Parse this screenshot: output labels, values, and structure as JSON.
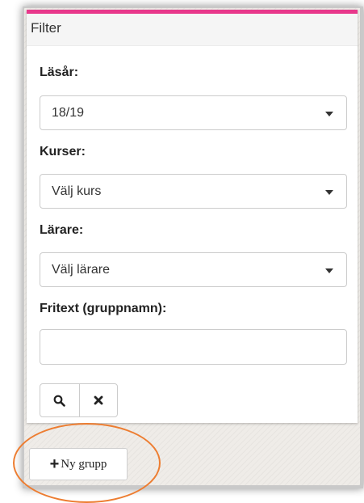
{
  "panel": {
    "heading": "Filter",
    "accent_color": "#e8388b"
  },
  "filters": {
    "year_label": "Läsår:",
    "year_value": "18/19",
    "courses_label": "Kurser:",
    "courses_value": "Välj kurs",
    "teachers_label": "Lärare:",
    "teachers_value": "Välj lärare",
    "freetext_label": "Fritext (gruppnamn):",
    "freetext_value": ""
  },
  "actions": {
    "search_icon": "search-icon",
    "clear_icon": "close-icon",
    "new_group_label": "Ny grupp",
    "new_group_icon": "plus-icon"
  },
  "annotation": {
    "highlight_color": "#ed7d31"
  }
}
